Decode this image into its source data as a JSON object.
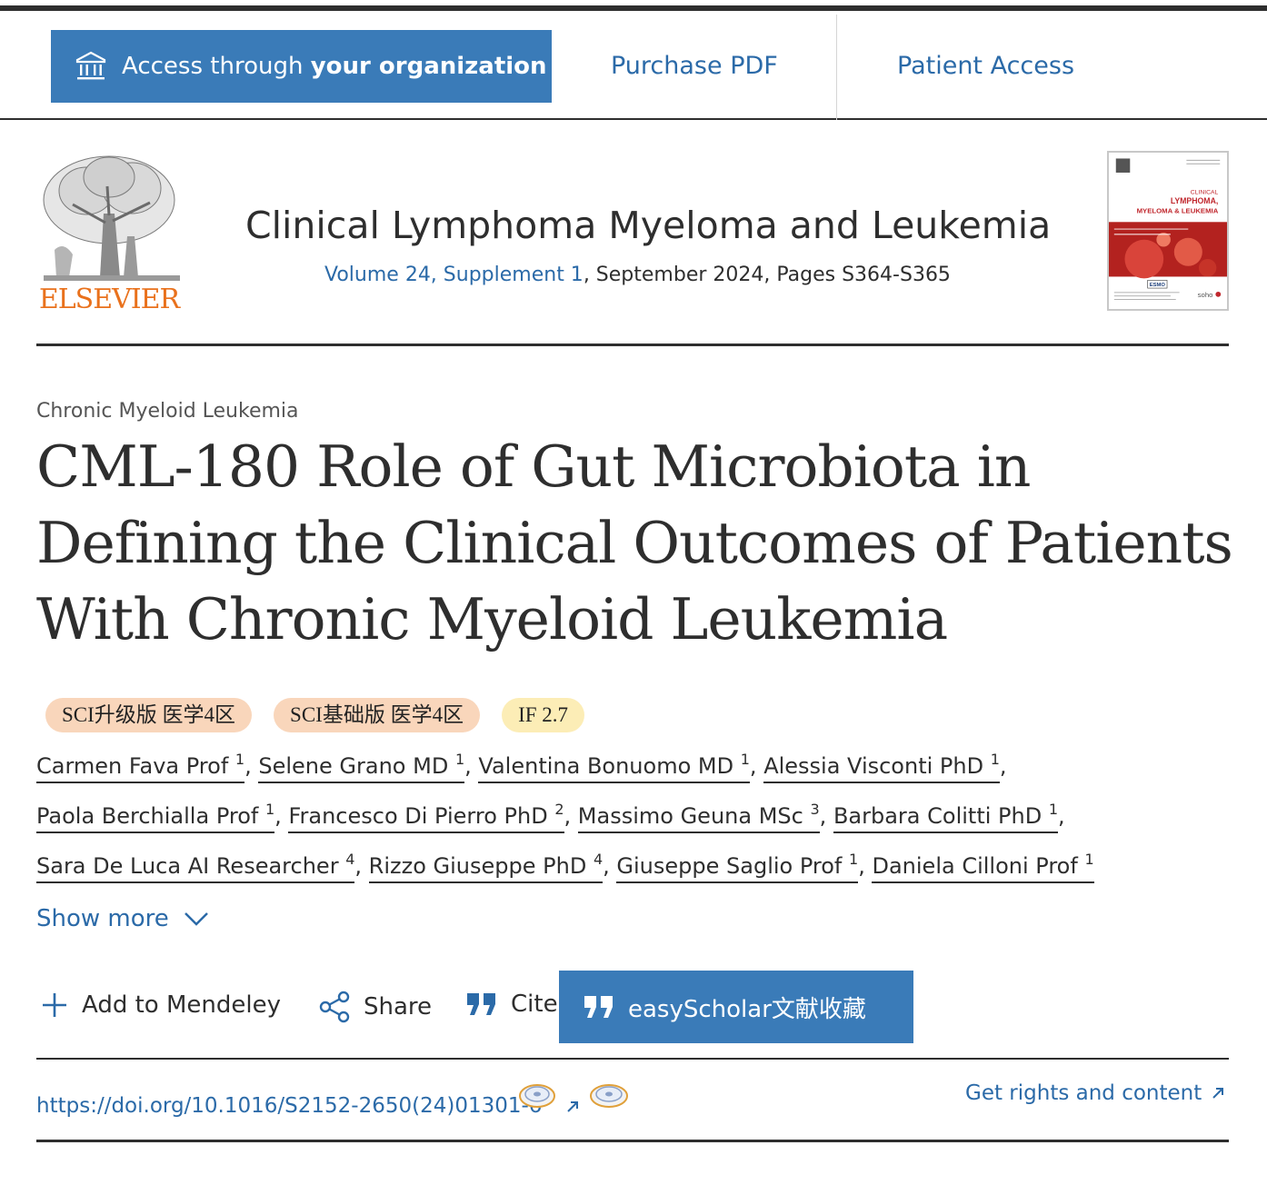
{
  "access_bar": {
    "org_button_prefix": "Access through",
    "org_button_bold": "your organization",
    "purchase": "Purchase PDF",
    "patient": "Patient Access"
  },
  "journal": {
    "publisher": "ELSEVIER",
    "title": "Clinical Lymphoma Myeloma and Leukemia",
    "volume_link": "Volume 24, Supplement 1",
    "issue_rest": ", September 2024, Pages S364-S365",
    "cover": {
      "line1": "CLINICAL",
      "line2": "LYMPHOMA,",
      "line3": "MYELOMA & LEUKEMIA",
      "badge": "ESMO",
      "footer": "soho"
    }
  },
  "article": {
    "section": "Chronic Myeloid Leukemia",
    "title": "CML-180 Role of Gut Microbiota in Defining the Clinical Outcomes of Patients With Chronic Myeloid Leukemia"
  },
  "badges": [
    "SCI升级版 医学4区",
    "SCI基础版 医学4区",
    "IF 2.7"
  ],
  "authors": [
    {
      "name": "Carmen Fava Prof",
      "sup": "1"
    },
    {
      "name": "Selene Grano MD",
      "sup": "1"
    },
    {
      "name": "Valentina Bonuomo MD",
      "sup": "1"
    },
    {
      "name": "Alessia Visconti PhD",
      "sup": "1"
    },
    {
      "name": "Paola Berchialla Prof",
      "sup": "1"
    },
    {
      "name": "Francesco Di Pierro PhD",
      "sup": "2"
    },
    {
      "name": "Massimo Geuna MSc",
      "sup": "3"
    },
    {
      "name": "Barbara Colitti PhD",
      "sup": "1"
    },
    {
      "name": "Sara De Luca AI Researcher",
      "sup": "4"
    },
    {
      "name": "Rizzo Giuseppe PhD",
      "sup": "4"
    },
    {
      "name": "Giuseppe Saglio Prof",
      "sup": "1"
    },
    {
      "name": "Daniela Cilloni Prof",
      "sup": "1"
    }
  ],
  "author_separator": ",",
  "show_more": "Show more",
  "actions": {
    "mendeley": "Add to Mendeley",
    "share": "Share",
    "cite": "Cite",
    "easyscholar": "easyScholar文献收藏"
  },
  "doi": "https://doi.org/10.1016/S2152-2650(24)01301-6",
  "rights": "Get rights and content",
  "icons": {
    "org": "institution-icon",
    "plus": "plus-icon",
    "share": "share-icon",
    "cite": "quote-icon",
    "chevron": "chevron-down-icon",
    "external": "external-link-icon"
  },
  "colors": {
    "link": "#2b6aa8",
    "button": "#3a7bb8",
    "publisher": "#e9711c",
    "badge_orange": "#f9d6bb",
    "badge_yellow": "#fcedb6"
  }
}
